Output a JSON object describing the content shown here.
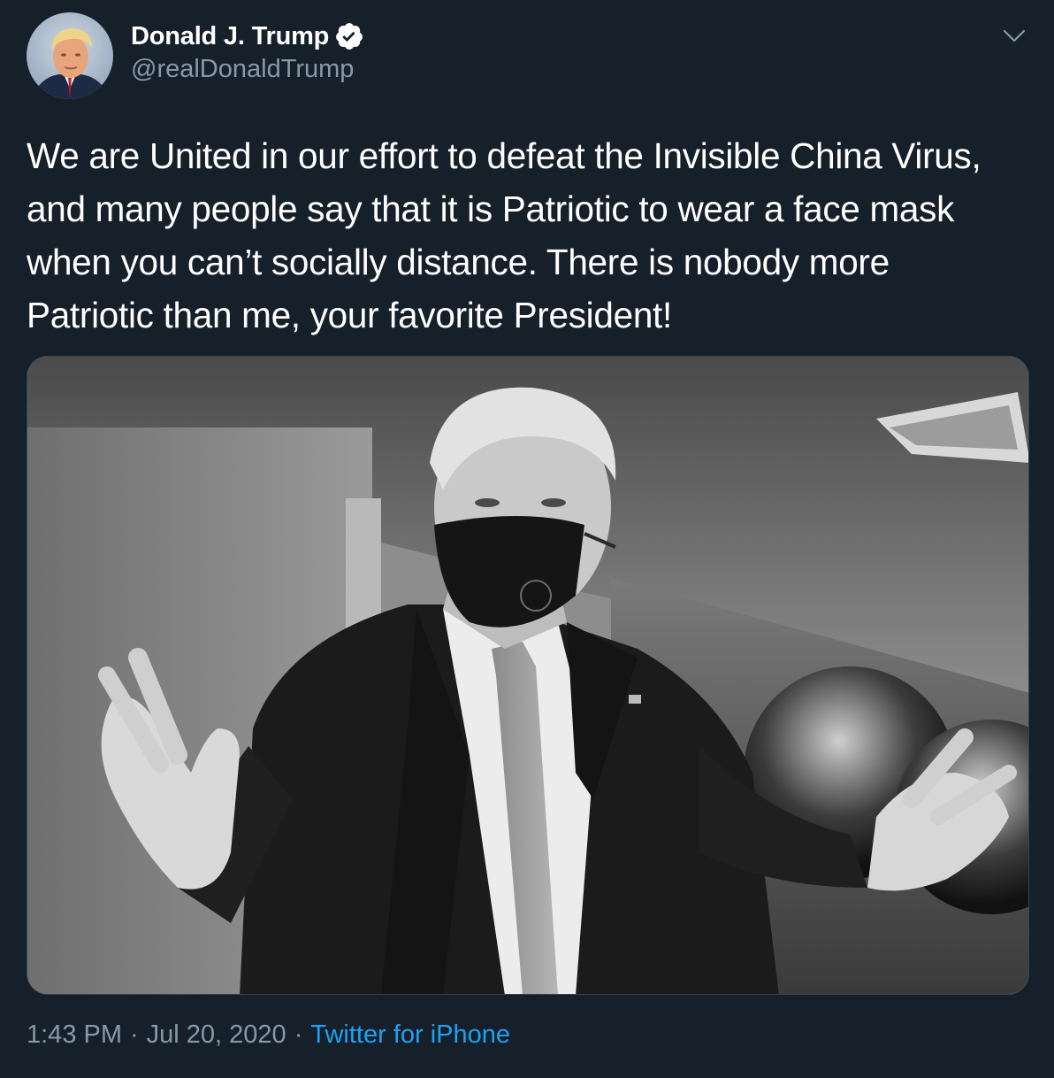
{
  "author": {
    "display_name": "Donald J. Trump",
    "handle": "@realDonaldTrump",
    "verified": true
  },
  "tweet": {
    "text": "We are United in our effort to defeat the Invisible China Virus, and many people say that it is Patriotic to wear a face mask when you can’t socially distance. There is nobody more Patriotic than me, your favorite President!"
  },
  "meta": {
    "time": "1:43 PM",
    "date": "Jul 20, 2020",
    "separator": "·",
    "source": "Twitter for iPhone"
  },
  "icons": {
    "verified": "verified-badge-icon",
    "menu": "chevron-down-icon"
  },
  "colors": {
    "background": "#15202b",
    "primary_text": "#ffffff",
    "secondary_text": "#8899a6",
    "link": "#1da1f2",
    "border": "#38444d"
  }
}
